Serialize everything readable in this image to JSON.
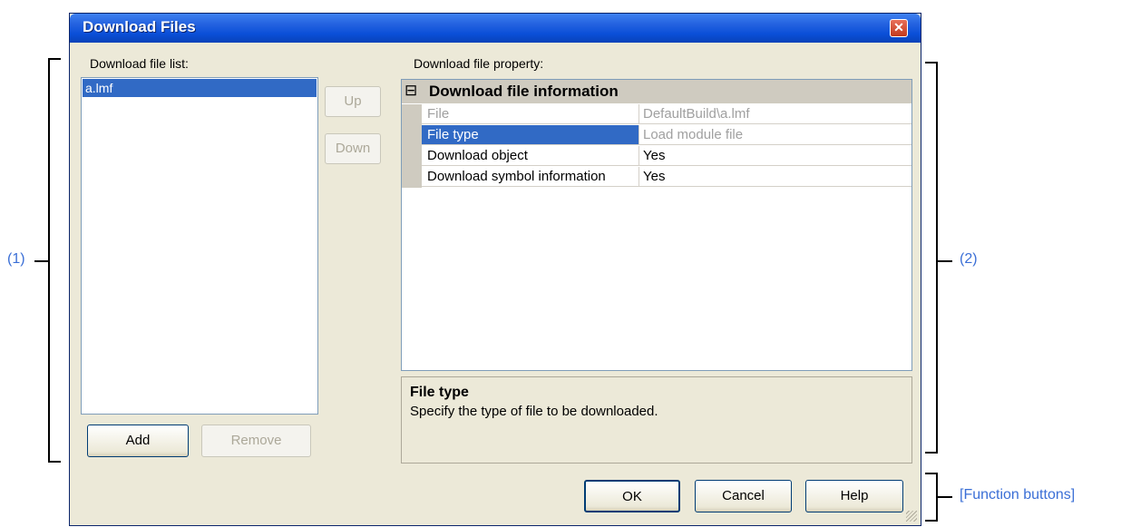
{
  "window": {
    "title": "Download Files",
    "close_glyph": "✕"
  },
  "file_list": {
    "label": "Download file list:",
    "items": [
      "a.lmf"
    ]
  },
  "buttons": {
    "up": "Up",
    "down": "Down",
    "add": "Add",
    "remove": "Remove"
  },
  "property": {
    "label": "Download file property:",
    "category": "Download file information",
    "category_toggle": "⊟",
    "rows": [
      {
        "name": "File",
        "value": "DefaultBuild\\a.lmf"
      },
      {
        "name": "File type",
        "value": "Load module file"
      },
      {
        "name": "Download object",
        "value": "Yes"
      },
      {
        "name": "Download symbol information",
        "value": "Yes"
      }
    ],
    "description": {
      "title": "File type",
      "text": "Specify the type of file to be downloaded."
    }
  },
  "function_buttons": {
    "ok": "OK",
    "cancel": "Cancel",
    "help": "Help"
  },
  "annotations": {
    "one": "(1)",
    "two": "(2)",
    "func": "[Function buttons]"
  },
  "colors": {
    "titlebar": "#0a4fd8",
    "selection": "#316ac5",
    "annotation": "#3b6fd6",
    "dialog_bg": "#ece9d8"
  }
}
